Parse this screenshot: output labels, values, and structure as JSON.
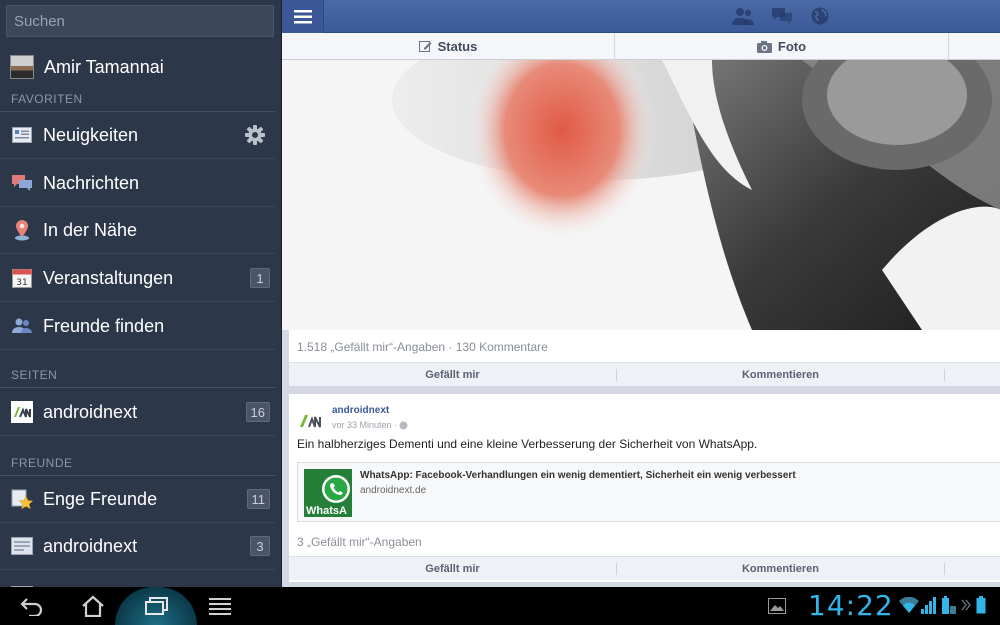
{
  "search": {
    "placeholder": "Suchen"
  },
  "profile": {
    "name": "Amir Tamannai"
  },
  "sections": {
    "favorites": "FAVORITEN",
    "pages": "SEITEN",
    "friends": "FREUNDE"
  },
  "favorites": [
    {
      "label": "Neuigkeiten",
      "icon": "news-feed-icon"
    },
    {
      "label": "Nachrichten",
      "icon": "messages-icon"
    },
    {
      "label": "In der Nähe",
      "icon": "location-pin-icon"
    },
    {
      "label": "Veranstaltungen",
      "icon": "calendar-icon",
      "calendar_day": "31",
      "badge": "1"
    },
    {
      "label": "Freunde finden",
      "icon": "friends-icon"
    }
  ],
  "pages": [
    {
      "label": "androidnext",
      "icon": "androidnext-logo-icon",
      "badge": "16"
    }
  ],
  "friends": [
    {
      "label": "Enge Freunde",
      "icon": "star-list-icon",
      "badge": "11"
    },
    {
      "label": "androidnext",
      "icon": "list-icon",
      "badge": "3"
    }
  ],
  "composer": {
    "status_label": "Status",
    "photo_label": "Foto"
  },
  "feed": {
    "post1": {
      "stats": "1.518 „Gefällt mir“-Angaben · 130 Kommentare",
      "like_label": "Gefällt mir",
      "comment_label": "Kommentieren"
    },
    "post2": {
      "author": "androidnext",
      "time": "vor 33 Minuten ·",
      "text": "Ein halbherziges Dementi und eine kleine Verbesserung der Sicherheit von WhatsApp.",
      "link_title": "WhatsApp: Facebook-Verhandlungen ein wenig dementiert, Sicherheit ein wenig verbessert",
      "link_domain": "androidnext.de",
      "thumb_text": "WhatsA",
      "likes": "3 „Gefällt mir“-Angaben",
      "like_label": "Gefällt mir",
      "comment_label": "Kommentieren"
    }
  },
  "system": {
    "clock": "14:22"
  },
  "colors": {
    "sidebar_bg": "#2c3749",
    "facebook_blue": "#3b5998",
    "clock_blue": "#31b6e7"
  }
}
